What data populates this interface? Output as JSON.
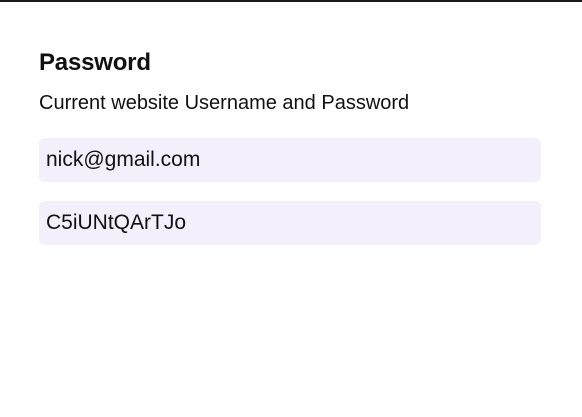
{
  "password_panel": {
    "title": "Password",
    "subtitle": "Current website Username and Password",
    "username_value": "nick@gmail.com",
    "password_value": "C5iUNtQArTJo"
  },
  "colors": {
    "field_background": "#f3f0fb",
    "text": "#111111",
    "top_border": "#1a1a1a"
  }
}
